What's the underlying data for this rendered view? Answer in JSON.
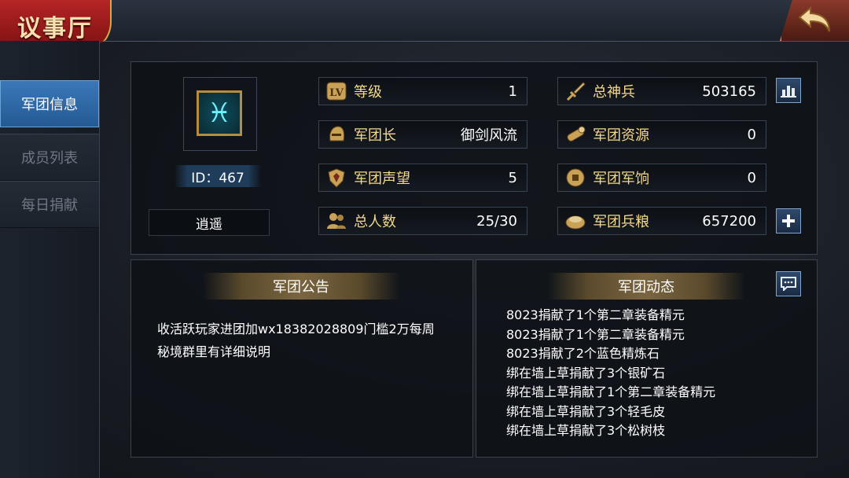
{
  "header": {
    "title": "议事厅",
    "back_icon": "back-arrow-icon"
  },
  "nav": [
    {
      "label": "军团信息",
      "active": true
    },
    {
      "label": "成员列表",
      "active": false
    },
    {
      "label": "每日捐献",
      "active": false
    }
  ],
  "guild": {
    "emblem_icon": "pisces-emblem-icon",
    "id_label": "ID：467",
    "name": "逍遥"
  },
  "stats_left": [
    {
      "icon": "level-icon",
      "label": "等级",
      "value": "1"
    },
    {
      "icon": "helmet-icon",
      "label": "军团长",
      "value": "御剑风流"
    },
    {
      "icon": "shield-icon",
      "label": "军团声望",
      "value": "5"
    },
    {
      "icon": "people-icon",
      "label": "总人数",
      "value": "25/30"
    }
  ],
  "stats_right": [
    {
      "icon": "sword-icon",
      "label": "总神兵",
      "value": "503165"
    },
    {
      "icon": "log-icon",
      "label": "军团资源",
      "value": "0"
    },
    {
      "icon": "coin-icon",
      "label": "军团军饷",
      "value": "0"
    },
    {
      "icon": "grain-icon",
      "label": "军团兵粮",
      "value": "657200"
    }
  ],
  "announcement": {
    "title": "军团公告",
    "lines": [
      "收活跃玩家进团加wx18382028809门槛2万每周",
      "秘境群里有详细说明"
    ]
  },
  "activity": {
    "title": "军团动态",
    "lines": [
      "8023捐献了1个第二章装备精元",
      "8023捐献了1个第二章装备精元",
      "8023捐献了2个蓝色精炼石",
      "绑在墙上草捐献了3个银矿石",
      "绑在墙上草捐献了1个第二章装备精元",
      "绑在墙上草捐献了3个轻毛皮",
      "绑在墙上草捐献了3个松树枝"
    ]
  },
  "colors": {
    "accent": "#3b78b8",
    "gold": "#f3d98a",
    "title_red": "#b52525"
  }
}
